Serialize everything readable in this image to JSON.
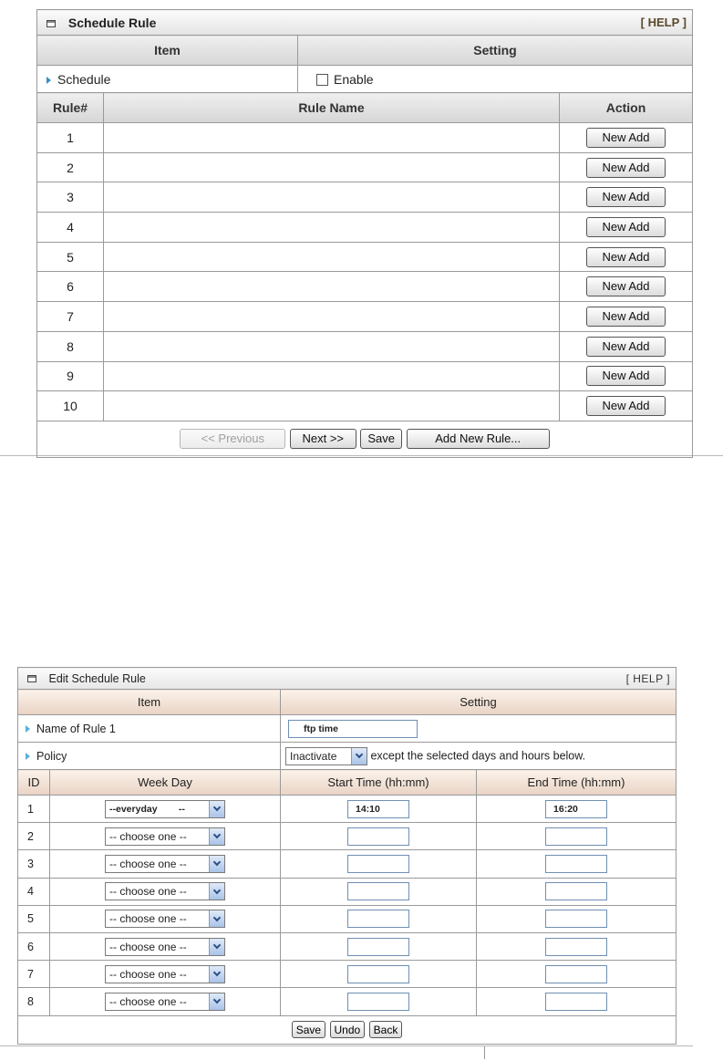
{
  "schedule_panel": {
    "title": "Schedule Rule",
    "help": "[ HELP ]",
    "col_item": "Item",
    "col_setting": "Setting",
    "schedule_label": "Schedule",
    "enable_label": "Enable",
    "rules_header": {
      "rule_num": "Rule#",
      "rule_name": "Rule Name",
      "action": "Action"
    },
    "rules": [
      {
        "num": "1",
        "name": "",
        "action": "New Add"
      },
      {
        "num": "2",
        "name": "",
        "action": "New Add"
      },
      {
        "num": "3",
        "name": "",
        "action": "New Add"
      },
      {
        "num": "4",
        "name": "",
        "action": "New Add"
      },
      {
        "num": "5",
        "name": "",
        "action": "New Add"
      },
      {
        "num": "6",
        "name": "",
        "action": "New Add"
      },
      {
        "num": "7",
        "name": "",
        "action": "New Add"
      },
      {
        "num": "8",
        "name": "",
        "action": "New Add"
      },
      {
        "num": "9",
        "name": "",
        "action": "New Add"
      },
      {
        "num": "10",
        "name": "",
        "action": "New Add"
      }
    ],
    "buttons": {
      "previous": "<< Previous",
      "next": "Next >>",
      "save": "Save",
      "add_new_rule": "Add New Rule..."
    }
  },
  "edit_panel": {
    "title": "Edit Schedule Rule",
    "help": "[ HELP ]",
    "col_item": "Item",
    "col_setting": "Setting",
    "name_label": "Name of Rule 1",
    "name_value": "ftp time",
    "policy_label": "Policy",
    "policy_value": "Inactivate",
    "policy_suffix": "except the selected days and hours below.",
    "table_header": {
      "id": "ID",
      "week_day": "Week Day",
      "start_time": "Start Time (hh:mm)",
      "end_time": "End Time (hh:mm)"
    },
    "rows": [
      {
        "id": "1",
        "week_day": "--everyday        --",
        "start": "14:10",
        "end": "16:20"
      },
      {
        "id": "2",
        "week_day": "-- choose one --",
        "start": "",
        "end": ""
      },
      {
        "id": "3",
        "week_day": "-- choose one --",
        "start": "",
        "end": ""
      },
      {
        "id": "4",
        "week_day": "-- choose one --",
        "start": "",
        "end": ""
      },
      {
        "id": "5",
        "week_day": "-- choose one --",
        "start": "",
        "end": ""
      },
      {
        "id": "6",
        "week_day": "-- choose one --",
        "start": "",
        "end": ""
      },
      {
        "id": "7",
        "week_day": "-- choose one --",
        "start": "",
        "end": ""
      },
      {
        "id": "8",
        "week_day": "-- choose one --",
        "start": "",
        "end": ""
      }
    ],
    "buttons": {
      "save": "Save",
      "undo": "Undo",
      "back": "Back"
    }
  }
}
